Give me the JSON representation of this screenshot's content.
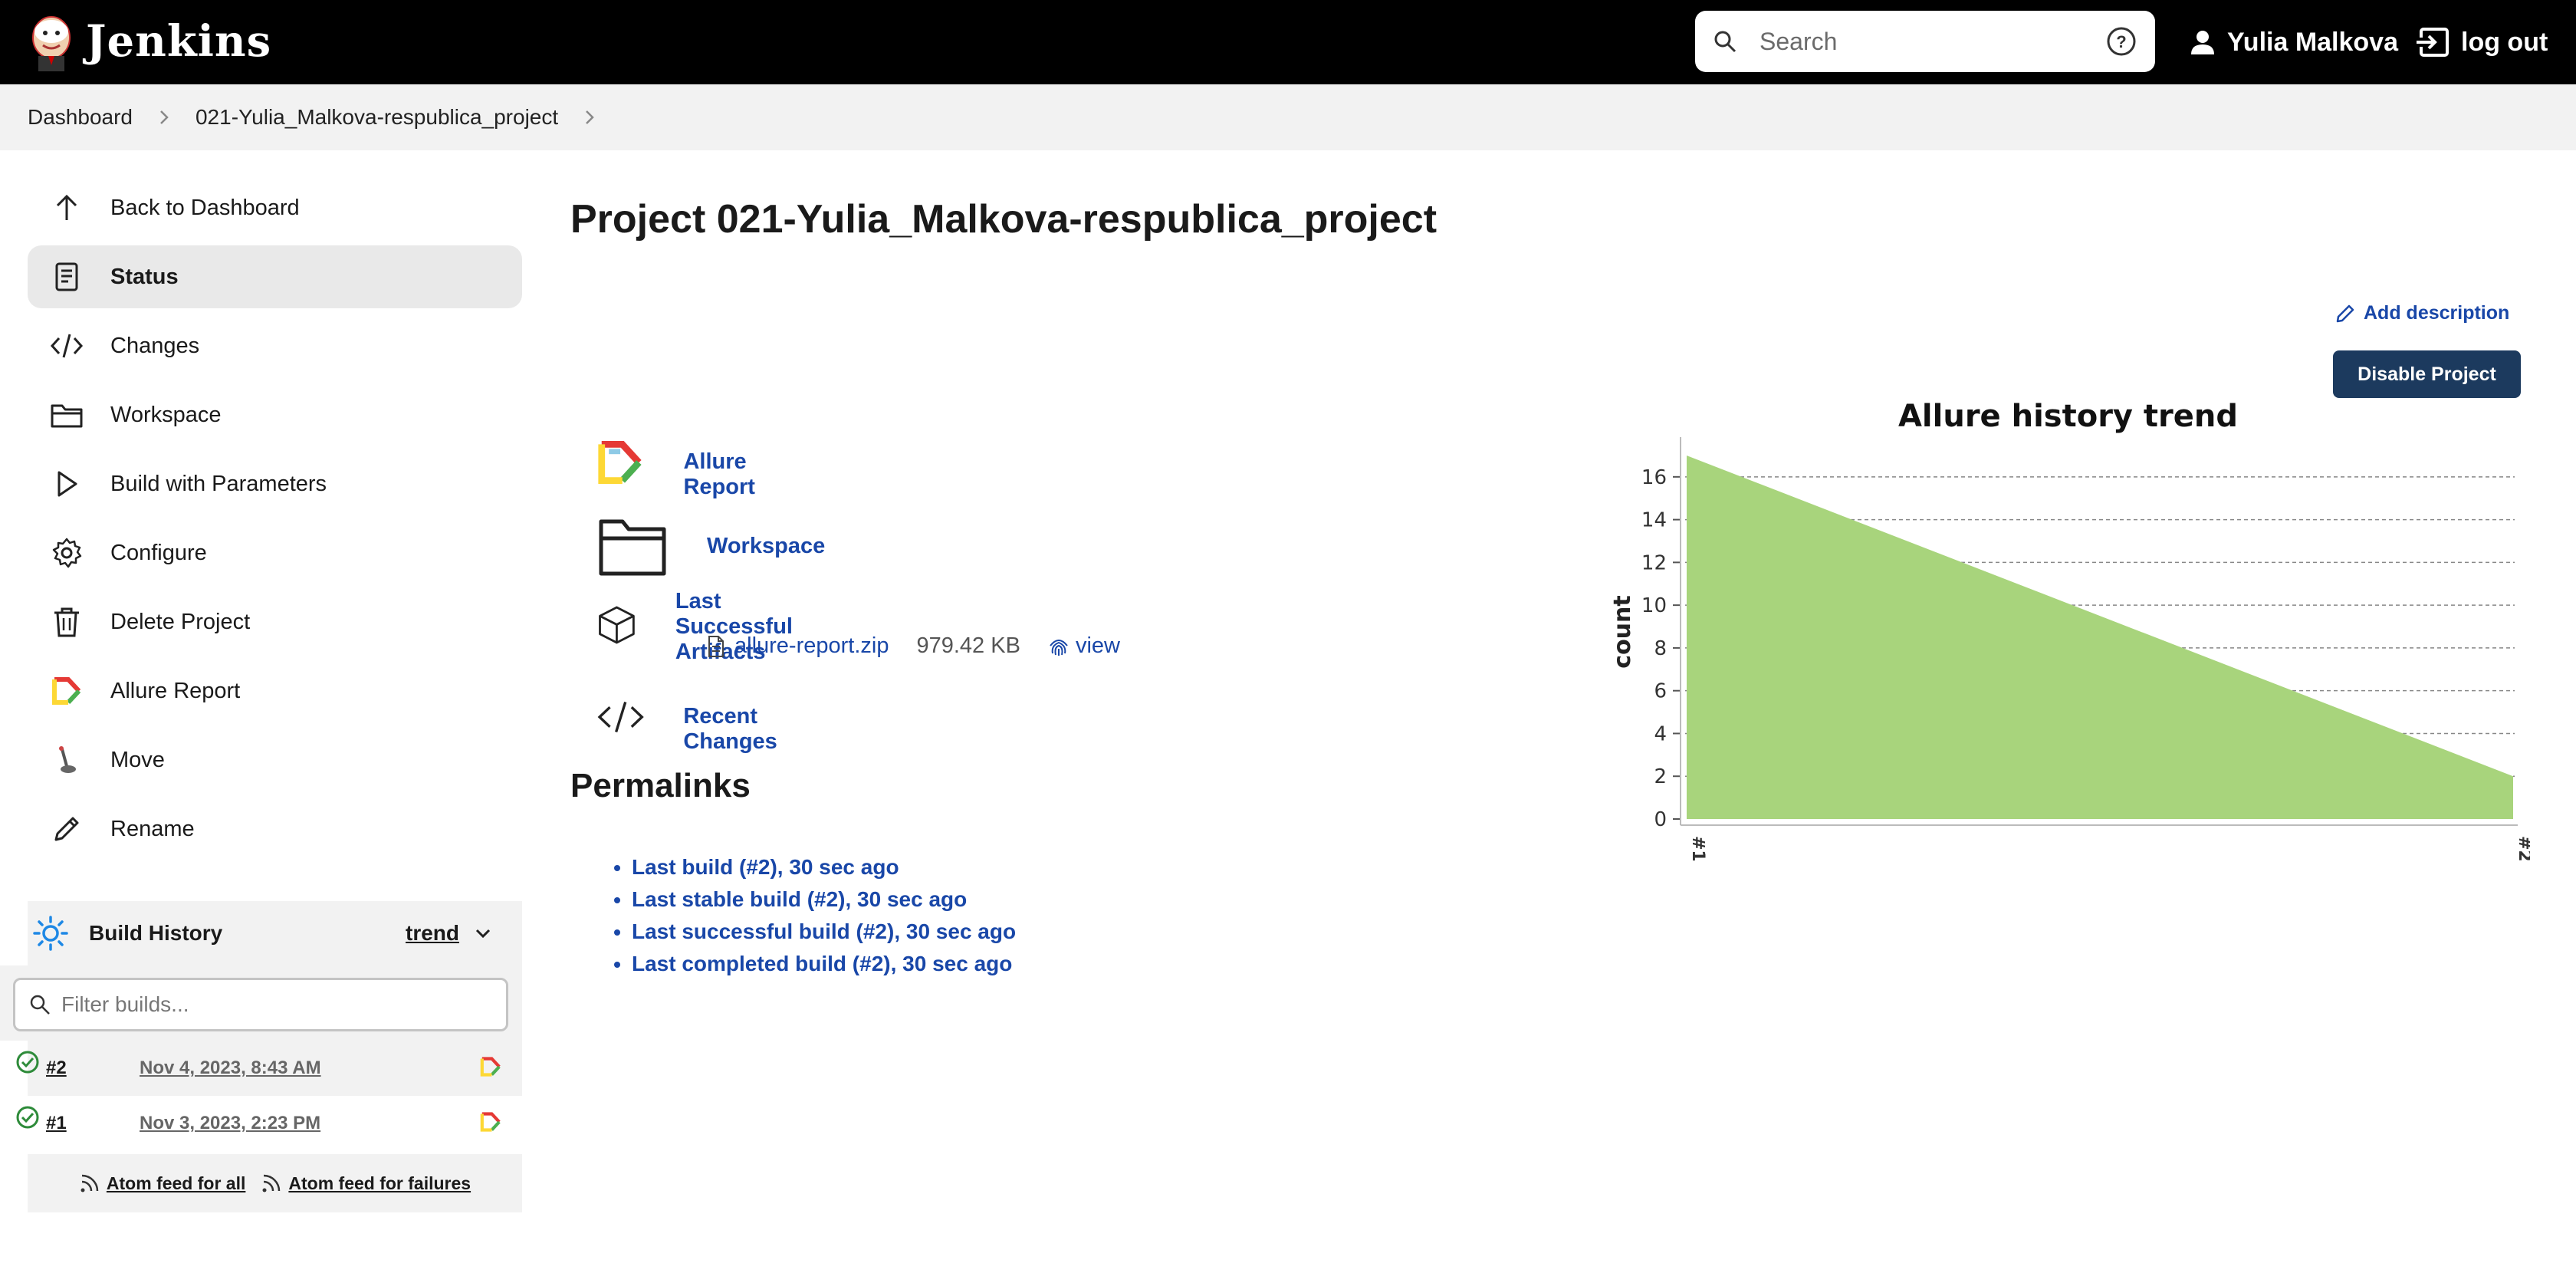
{
  "header": {
    "brand": "Jenkins",
    "search_placeholder": "Search",
    "user_name": "Yulia Malkova",
    "logout_label": "log out"
  },
  "breadcrumb": [
    "Dashboard",
    "021-Yulia_Malkova-respublica_project"
  ],
  "sidebar": {
    "items": [
      {
        "label": "Back to Dashboard",
        "icon": "arrow-up-icon"
      },
      {
        "label": "Status",
        "icon": "document-icon",
        "active": true
      },
      {
        "label": "Changes",
        "icon": "code-icon"
      },
      {
        "label": "Workspace",
        "icon": "folder-icon"
      },
      {
        "label": "Build with Parameters",
        "icon": "play-icon"
      },
      {
        "label": "Configure",
        "icon": "gear-icon"
      },
      {
        "label": "Delete Project",
        "icon": "trash-icon"
      },
      {
        "label": "Allure Report",
        "icon": "allure-icon"
      },
      {
        "label": "Move",
        "icon": "move-icon"
      },
      {
        "label": "Rename",
        "icon": "pencil-icon"
      }
    ]
  },
  "build_history": {
    "title": "Build History",
    "trend_label": "trend",
    "filter_placeholder": "Filter builds...",
    "builds": [
      {
        "number": "#2",
        "date": "Nov 4, 2023, 8:43 AM"
      },
      {
        "number": "#1",
        "date": "Nov 3, 2023, 2:23 PM"
      }
    ],
    "feed_all": "Atom feed for all",
    "feed_failures": "Atom feed for failures"
  },
  "main": {
    "title": "Project 021-Yulia_Malkova-respublica_project",
    "add_description": "Add description",
    "disable_button": "Disable Project",
    "links": {
      "allure_report": "Allure Report",
      "workspace": "Workspace",
      "last_artifacts": "Last Successful Artifacts",
      "artifact_name": "allure-report.zip",
      "artifact_size": "979.42 KB",
      "artifact_view": "view",
      "recent_changes": "Recent Changes"
    },
    "permalinks_title": "Permalinks",
    "permalinks": [
      "Last build (#2), 30 sec ago",
      "Last stable build (#2), 30 sec ago",
      "Last successful build (#2), 30 sec ago",
      "Last completed build (#2), 30 sec ago"
    ]
  },
  "colors": {
    "header_bg": "#000000",
    "link": "#1947a8",
    "button_bg": "#1c3a5e",
    "area_fill": "#a8d47c",
    "success_green": "#2e8b3a"
  },
  "chart_data": {
    "type": "area",
    "title": "Allure history trend",
    "ylabel": "count",
    "xlabel": "",
    "categories": [
      "#1",
      "#2"
    ],
    "series": [
      {
        "values": [
          17,
          2
        ]
      }
    ],
    "ylim": [
      0,
      17.5
    ],
    "yticks": [
      0,
      2,
      4,
      6,
      8,
      10,
      12,
      14,
      16
    ],
    "grid": true
  }
}
